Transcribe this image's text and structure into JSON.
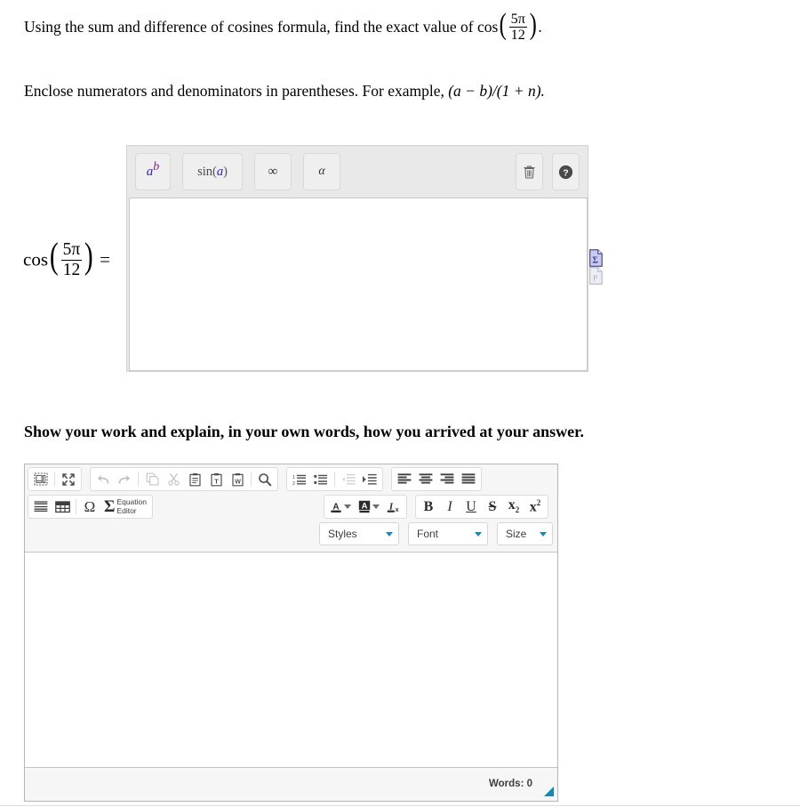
{
  "question": {
    "line1_pre": "Using the sum and difference of cosines formula, find the exact value of ",
    "line1_fn": "cos",
    "line1_num": "5π",
    "line1_den": "12",
    "line1_post": ".",
    "line2_pre": "Enclose numerators and denominators in parentheses. For example, ",
    "line2_expr": "(a − b)/(1 + n).",
    "line3": "Show your work and explain, in your own words, how you arrived at your answer."
  },
  "equation_label": {
    "fn": "cos",
    "num": "5π",
    "den": "12",
    "equals": "="
  },
  "math_editor": {
    "buttons": [
      {
        "name": "power-button",
        "base": "a",
        "exponent": "b",
        "title": "Exponent"
      },
      {
        "name": "sin-button",
        "label": "sin",
        "open": "(",
        "arg": "a",
        "close": ")",
        "title": "Trigonometric function"
      },
      {
        "name": "infinity-button",
        "glyph": "∞",
        "title": "Infinity"
      },
      {
        "name": "alpha-button",
        "glyph": "α",
        "title": "Greek letters"
      }
    ],
    "trash_title": "Clear",
    "help_title": "Help",
    "help_glyph": "?",
    "input_value": "",
    "input_placeholder": ""
  },
  "doc_icons": [
    {
      "name": "math-preview-icon",
      "glyph": "Σ",
      "state": "enabled"
    },
    {
      "name": "plain-text-preview-icon",
      "glyph": "P",
      "state": "disabled"
    }
  ],
  "rte": {
    "row1_group1": [
      {
        "name": "source-button",
        "icon": "source",
        "disabled": false
      },
      {
        "name": "maximize-button",
        "icon": "maximize",
        "disabled": false
      }
    ],
    "row1_group2": [
      {
        "name": "undo-button",
        "icon": "undo",
        "disabled": true
      },
      {
        "name": "redo-button",
        "icon": "redo",
        "disabled": true
      },
      {
        "name": "copy-button",
        "icon": "copy",
        "disabled": true
      },
      {
        "name": "cut-button",
        "icon": "cut",
        "disabled": true
      },
      {
        "name": "paste-button",
        "icon": "paste",
        "disabled": false
      },
      {
        "name": "paste-as-text-button",
        "icon": "paste-text",
        "disabled": false
      },
      {
        "name": "paste-from-word-button",
        "icon": "paste-word",
        "disabled": false
      },
      {
        "name": "find-button",
        "icon": "search",
        "disabled": false
      }
    ],
    "row1_group3": [
      {
        "name": "numbered-list-button",
        "icon": "ol",
        "disabled": false
      },
      {
        "name": "bulleted-list-button",
        "icon": "ul",
        "disabled": false
      },
      {
        "name": "outdent-button",
        "icon": "outdent",
        "disabled": true
      },
      {
        "name": "indent-button",
        "icon": "indent",
        "disabled": false
      }
    ],
    "row1_group4": [
      {
        "name": "align-left-button",
        "icon": "align-left",
        "disabled": false
      },
      {
        "name": "align-center-button",
        "icon": "align-center",
        "disabled": false
      },
      {
        "name": "align-right-button",
        "icon": "align-right",
        "disabled": false
      },
      {
        "name": "align-justify-button",
        "icon": "align-justify",
        "disabled": false
      }
    ],
    "row2_group1": [
      {
        "name": "horizontal-rule-button",
        "icon": "hr",
        "disabled": false
      },
      {
        "name": "table-button",
        "icon": "table",
        "disabled": false
      },
      {
        "name": "special-character-button",
        "icon": "omega",
        "glyph": "Ω",
        "disabled": false
      }
    ],
    "equation_editor": {
      "name": "equation-editor-button",
      "glyph": "Σ",
      "label_line1": "Equation",
      "label_line2": "Editor"
    },
    "row2_group2": [
      {
        "name": "text-color-button",
        "icon": "text-color",
        "glyph": "A",
        "disabled": false
      },
      {
        "name": "background-color-button",
        "icon": "bg-color",
        "glyph": "A",
        "disabled": false
      },
      {
        "name": "remove-format-button",
        "icon": "remove-format",
        "glyph": "I",
        "sub": "x",
        "disabled": false
      }
    ],
    "row2_group3": [
      {
        "name": "bold-button",
        "glyph": "B",
        "style": "b"
      },
      {
        "name": "italic-button",
        "glyph": "I",
        "style": "i"
      },
      {
        "name": "underline-button",
        "glyph": "U",
        "style": "u"
      },
      {
        "name": "strikethrough-button",
        "glyph": "S",
        "style": "s"
      },
      {
        "name": "subscript-button",
        "glyph": "x",
        "affix": "2",
        "style": "sub"
      },
      {
        "name": "superscript-button",
        "glyph": "x",
        "affix": "2",
        "style": "sup"
      }
    ],
    "combos": [
      {
        "name": "styles-dropdown",
        "label": "Styles"
      },
      {
        "name": "font-dropdown",
        "label": "Font"
      },
      {
        "name": "size-dropdown",
        "label": "Size"
      }
    ],
    "body_value": "",
    "footer": {
      "word_count_label": "Words: 0"
    }
  },
  "colors": {
    "accent_teal": "#1289b9",
    "math_blue": "#2525d0",
    "math_purple": "#8a2090",
    "panel_gray": "#e9e9e9",
    "toolbar_gray": "#f6f6f6"
  }
}
